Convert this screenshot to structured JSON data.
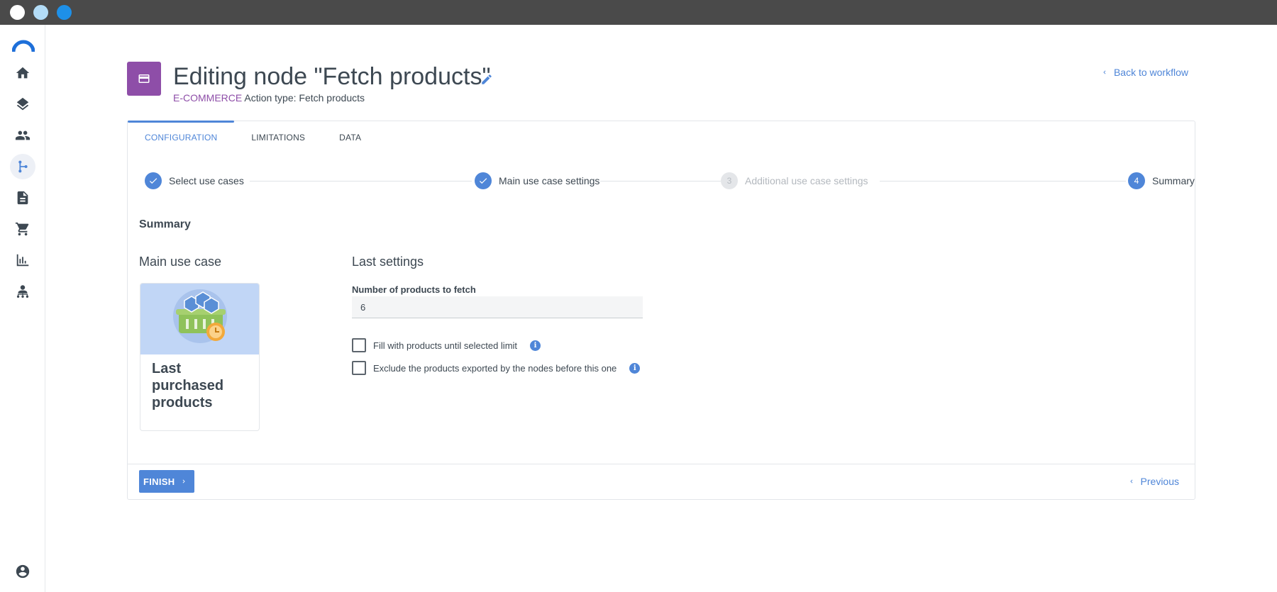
{
  "window": {
    "dots": [
      "#ffffff",
      "#b3dcf7",
      "#1e90e8"
    ]
  },
  "sidebar": {
    "items": [
      {
        "icon": "home-icon"
      },
      {
        "icon": "layers-icon"
      },
      {
        "icon": "people-icon"
      },
      {
        "icon": "workflow-icon",
        "active": true
      },
      {
        "icon": "document-icon"
      },
      {
        "icon": "cart-icon"
      },
      {
        "icon": "bar-chart-icon"
      },
      {
        "icon": "network-user-icon"
      }
    ],
    "bottom_icon": "account-icon"
  },
  "header": {
    "title": "Editing node \"Fetch products\"",
    "category": "E-COMMERCE",
    "action_type": "Action type: Fetch products",
    "back_label": "Back to workflow",
    "accent_color": "#8e4ea8"
  },
  "tabs": [
    {
      "label": "CONFIGURATION",
      "active": true
    },
    {
      "label": "LIMITATIONS"
    },
    {
      "label": "DATA"
    }
  ],
  "steps": [
    {
      "label": "Select use cases",
      "state": "done",
      "num": "1"
    },
    {
      "label": "Main use case settings",
      "state": "done",
      "num": "2"
    },
    {
      "label": "Additional use case settings",
      "state": "pending",
      "num": "3"
    },
    {
      "label": "Summary",
      "state": "current",
      "num": "4"
    }
  ],
  "summary": {
    "title": "Summary",
    "main_use_case_title": "Main use case",
    "use_case_label": "Last purchased products",
    "last_settings_title": "Last settings",
    "products_field_label": "Number of products to fetch",
    "products_field_value": "6",
    "checkbox_fill_label": "Fill with products until selected limit",
    "checkbox_exclude_label": "Exclude the products exported by the nodes before this one"
  },
  "footer": {
    "finish_label": "FINISH",
    "previous_label": "Previous"
  },
  "colors": {
    "primary": "#4f86d8",
    "titlebar": "#4a4a4a"
  }
}
